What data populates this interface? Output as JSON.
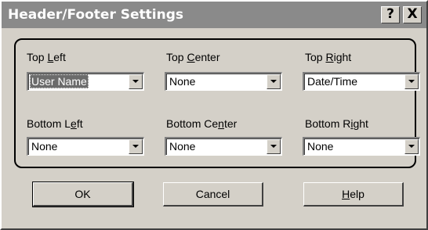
{
  "window": {
    "title": "Header/Footer Settings",
    "help_button": "?",
    "close_button": "X"
  },
  "fields": {
    "top_left": {
      "label_pre": "Top ",
      "label_key": "L",
      "label_post": "eft",
      "value": "User Name"
    },
    "top_center": {
      "label_pre": "Top ",
      "label_key": "C",
      "label_post": "enter",
      "value": "None"
    },
    "top_right": {
      "label_pre": "Top ",
      "label_key": "R",
      "label_post": "ight",
      "value": "Date/Time"
    },
    "bottom_left": {
      "label_pre": "Bottom L",
      "label_key": "e",
      "label_post": "ft",
      "value": "None"
    },
    "bottom_center": {
      "label_pre": "Bottom Ce",
      "label_key": "n",
      "label_post": "ter",
      "value": "None"
    },
    "bottom_right": {
      "label_pre": "Bottom R",
      "label_key": "i",
      "label_post": "ght",
      "value": "None"
    }
  },
  "buttons": {
    "ok": "OK",
    "cancel": "Cancel",
    "help_key": "H",
    "help_rest": "elp"
  },
  "icons": {
    "dropdown": "chevron-down-icon"
  }
}
